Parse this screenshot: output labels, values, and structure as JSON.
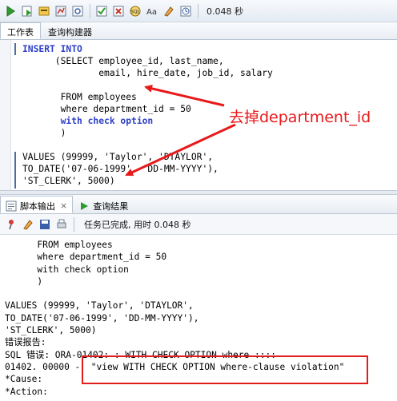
{
  "toolbar": {
    "icons": [
      "run-statement-icon",
      "run-script-icon",
      "explain-plan-icon",
      "autotrace-icon",
      "sql-tuning-icon",
      "commit-icon",
      "rollback-icon",
      "sql-icon",
      "uppercase-icon",
      "clear-icon",
      "history-icon"
    ],
    "timing": "0.048 秒"
  },
  "tabs": [
    {
      "label": "工作表",
      "active": true
    },
    {
      "label": "查询构建器",
      "active": false
    }
  ],
  "editor": {
    "lines": [
      "INSERT INTO",
      "      (SELECT employee_id, last_name,",
      "              email, hire_date, job_id, salary",
      "",
      "       FROM employees",
      "       where department_id = 50",
      "       with check option",
      "       )",
      "",
      "VALUES (99999, 'Taylor', 'DTAYLOR',",
      "TO_DATE('07-06-1999', 'DD-MM-YYYY'),",
      "'ST_CLERK', 5000)"
    ]
  },
  "annotation": {
    "text": "去掉department_id",
    "color": "#e8191b"
  },
  "bottom_tabs": [
    {
      "label": "脚本输出",
      "active": true
    },
    {
      "label": "查询结果",
      "active": false
    }
  ],
  "bottom_toolbar": {
    "status": "任务已完成, 用时 0.048 秒"
  },
  "output": {
    "lines": [
      "      FROM employees",
      "      where department_id = 50",
      "      with check option",
      "      )",
      "",
      "VALUES (99999, 'Taylor', 'DTAYLOR',",
      "TO_DATE('07-06-1999', 'DD-MM-YYYY'),",
      "'ST_CLERK', 5000)",
      "错误报告:",
      "SQL 错误: ORA-01402: : WITH CHECK OPTION where ::::",
      "01402. 00000 -  \"view WITH CHECK OPTION where-clause violation\"",
      "*Cause:",
      "*Action:"
    ]
  }
}
